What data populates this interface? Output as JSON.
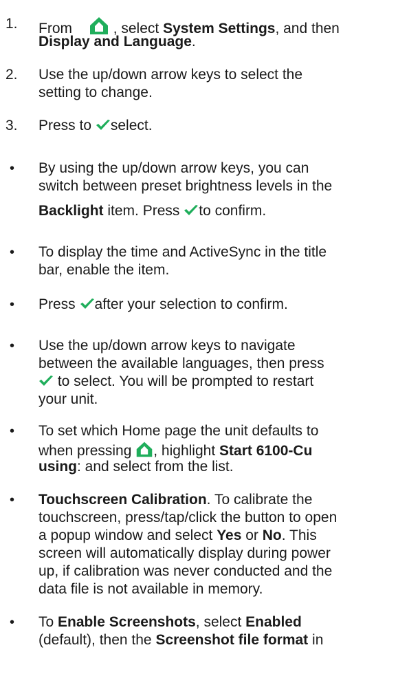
{
  "step1": {
    "number": "1.",
    "from": "From",
    "select": ", select",
    "system_settings": "System Settings",
    "and_then": ", and then",
    "display_language": "Display and Language",
    "period": "."
  },
  "step2": {
    "number": "2.",
    "line1": "Use the up/down arrow keys to select the",
    "line2": "setting to change."
  },
  "step3": {
    "number": "3.",
    "press_to": "Press to",
    "select": "select."
  },
  "bullets": {
    "marker": "•",
    "backlight": {
      "line1": "By using the up/down arrow keys, you can",
      "line2": "switch between preset brightness levels in the",
      "backlight": "Backlight",
      "item_press": " item. Press",
      "to_confirm": "to confirm."
    },
    "time": {
      "line1": "To display the time and ActiveSync in the title",
      "line2": "bar, enable the item."
    },
    "press_confirm": {
      "press": "Press",
      "after": "after your selection to confirm."
    },
    "languages": {
      "line1": "Use the up/down arrow keys to navigate",
      "line2": "between the available languages, then press",
      "line3": " to select. You will be prompted to restart",
      "line4": "your unit."
    },
    "home_page": {
      "line1": "To set which Home page the unit defaults to",
      "when_pressing": "when pressing",
      "comma": ", highlight",
      "start": "Start 6100-Cu",
      "using": "using",
      "rest": ": and select from the list."
    },
    "touchscreen": {
      "title": "Touchscreen Calibration",
      "line1_rest": ". To calibrate the",
      "line2": "touchscreen, press/tap/click the button to open",
      "line3_pre": "a popup window and select",
      "yes": "Yes",
      "or": " or ",
      "no": "No",
      "line3_post": ". This",
      "line4": "screen will automatically display during power",
      "line5": "up, if calibration was never conducted and the",
      "line6": "data file is not available in memory."
    },
    "screenshots": {
      "to": "To",
      "enable": "Enable Screenshots",
      "select": ", select",
      "enabled": "Enabled",
      "default": "(default), then the",
      "format": "Screenshot file format",
      "in": " in"
    }
  },
  "colors": {
    "home_icon": "#1fae5b",
    "check_icon": "#1fae5b",
    "text": "#1a1a1a"
  },
  "icons": {
    "home": "home-icon",
    "check": "check-icon"
  }
}
